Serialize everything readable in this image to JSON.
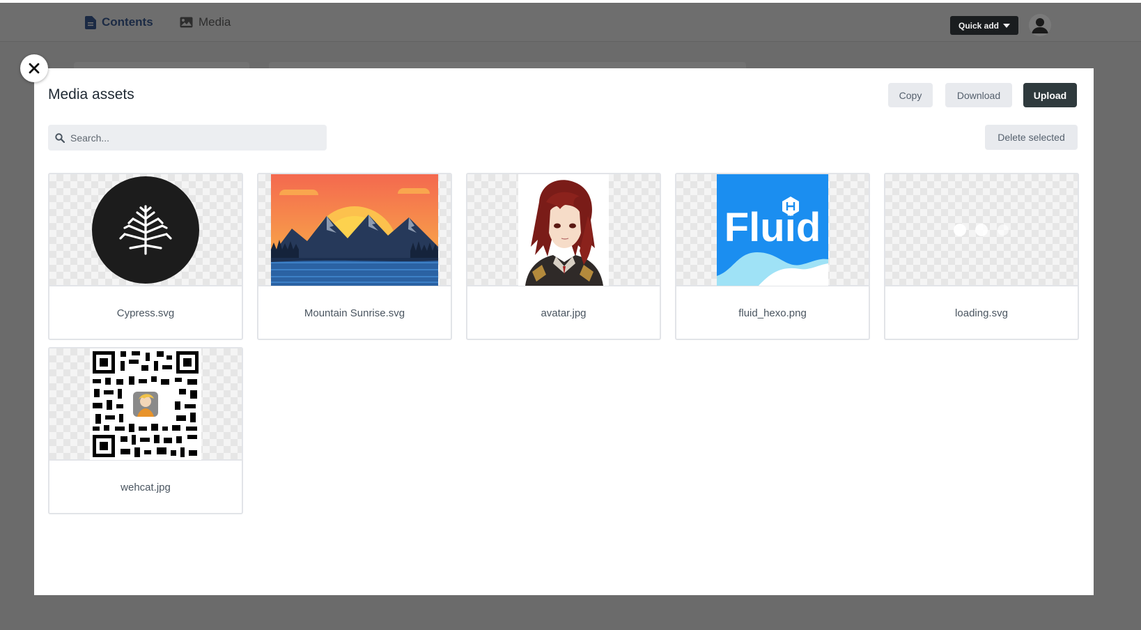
{
  "nav": {
    "contents_label": "Contents",
    "media_label": "Media",
    "quick_add_label": "Quick add"
  },
  "modal": {
    "title": "Media assets",
    "copy_label": "Copy",
    "download_label": "Download",
    "upload_label": "Upload",
    "delete_selected_label": "Delete selected",
    "search_placeholder": "Search..."
  },
  "assets": [
    {
      "name": "Cypress.svg",
      "icon": "cypress-logo"
    },
    {
      "name": "Mountain Sunrise.svg",
      "icon": "mountain-sunrise-image"
    },
    {
      "name": "avatar.jpg",
      "icon": "anime-avatar-image"
    },
    {
      "name": "fluid_hexo.png",
      "icon": "fluid-logo"
    },
    {
      "name": "loading.svg",
      "icon": "loading-dots"
    },
    {
      "name": "wehcat.jpg",
      "icon": "qr-code-image"
    }
  ],
  "fluid_logo_text": "Fluid",
  "colors": {
    "overlay": "#6b6b6b",
    "upload_button": "#2f3a3d",
    "fluid_blue": "#1b8ef0",
    "nav_active": "#1b2a44"
  }
}
